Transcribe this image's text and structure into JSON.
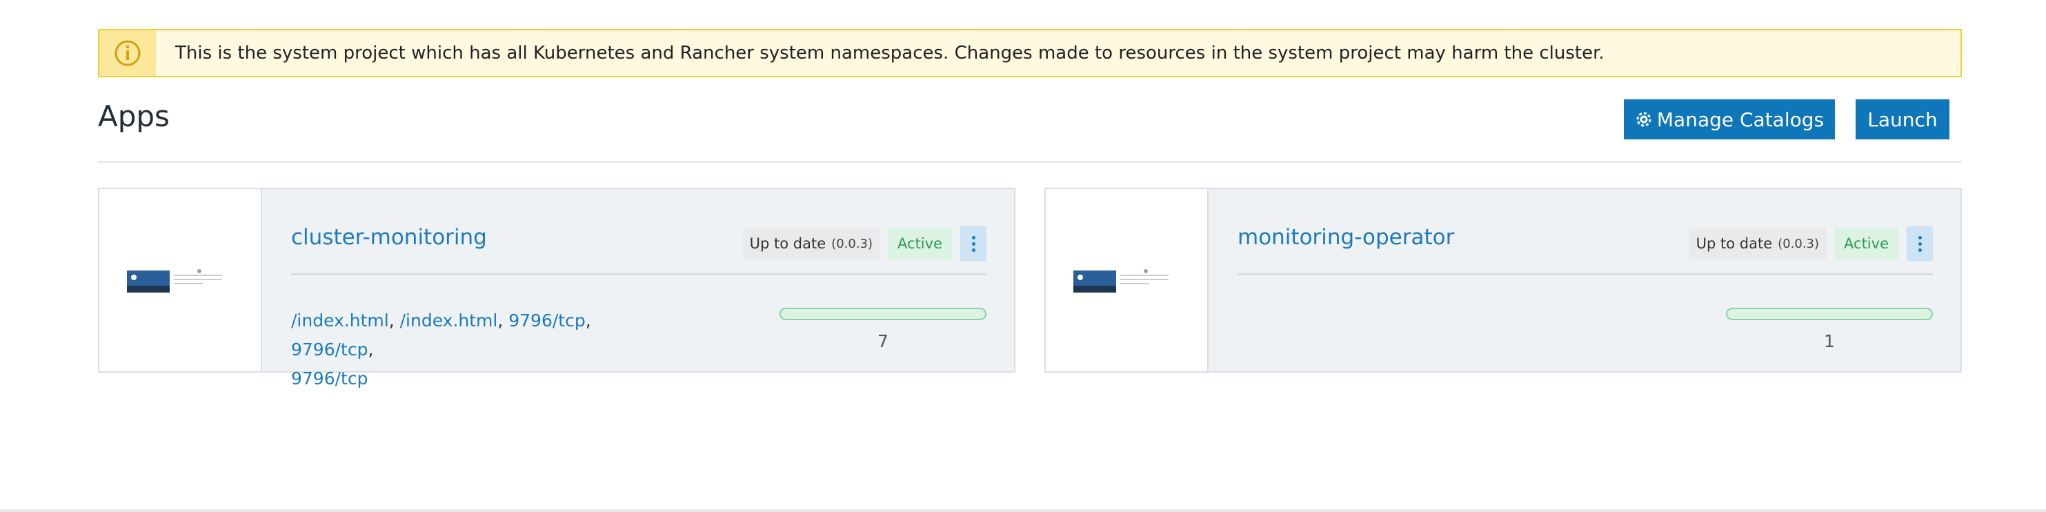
{
  "banner": {
    "icon": "info-icon",
    "message": "This is the system project which has all Kubernetes and Rancher system namespaces. Changes made to resources in the system project may harm the cluster."
  },
  "header": {
    "title": "Apps",
    "manage_catalogs_label": "Manage Catalogs",
    "manage_catalogs_icon": "gear-icon",
    "launch_label": "Launch"
  },
  "apps": [
    {
      "name": "cluster-monitoring",
      "status_update": "Up to date",
      "version": "(0.0.3)",
      "state": "Active",
      "endpoints": [
        "/index.html",
        "/index.html",
        "9796/tcp",
        "9796/tcp",
        "9796/tcp"
      ],
      "progress": 1.0,
      "count": "7"
    },
    {
      "name": "monitoring-operator",
      "status_update": "Up to date",
      "version": "(0.0.3)",
      "state": "Active",
      "endpoints": [],
      "progress": 1.0,
      "count": "1"
    }
  ],
  "colors": {
    "accent": "#0f76b9",
    "link": "#1d7ac0",
    "active_bg": "#dcf3e3",
    "active_text": "#2f9b56",
    "banner_bg": "#fff9e0",
    "banner_border": "#f0cf3a"
  }
}
